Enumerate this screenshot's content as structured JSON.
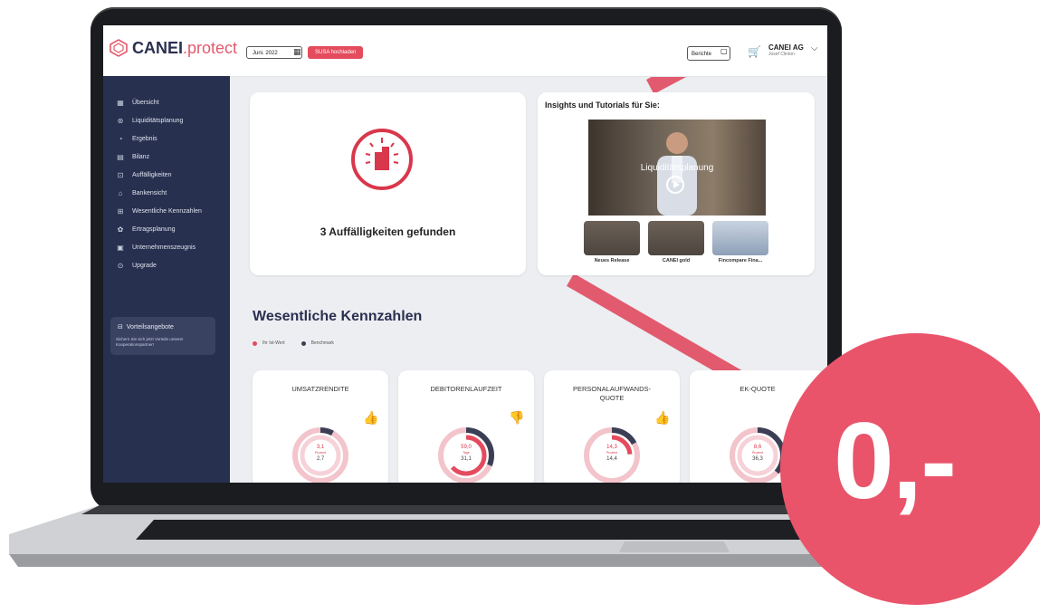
{
  "app": {
    "brand_main": "CANEI",
    "brand_accent": ".protect"
  },
  "topbar": {
    "date": "Juni. 2022",
    "susa_button": "SUSA hochladen",
    "reports_button": "Berichte",
    "user_company": "CANEI AG",
    "user_name": "Josef Clinton"
  },
  "sidebar": {
    "items": [
      {
        "label": "Übersicht",
        "icon": "grid-icon"
      },
      {
        "label": "Liquiditätsplanung",
        "icon": "liquidity-icon"
      },
      {
        "label": "Ergebnis",
        "icon": "result-icon"
      },
      {
        "label": "Bilanz",
        "icon": "balance-icon"
      },
      {
        "label": "Auffälligkeiten",
        "icon": "alert-icon"
      },
      {
        "label": "Bankensicht",
        "icon": "bank-icon"
      },
      {
        "label": "Wesentliche Kennzahlen",
        "icon": "kpi-icon"
      },
      {
        "label": "Ertragsplanung",
        "icon": "revenue-icon"
      },
      {
        "label": "Unternehmenszeugnis",
        "icon": "certificate-icon"
      },
      {
        "label": "Upgrade",
        "icon": "upgrade-icon"
      }
    ],
    "offer_title": "Vorteilsangebote",
    "offer_text": "Sichern Sie sich jetzt Vorteile unserer Kooperationspartner!"
  },
  "alert_card": {
    "title": "3 Auffälligkeiten gefunden"
  },
  "insights": {
    "title": "Insights und Tutorials für Sie:",
    "video_label": "Liquiditätsplanung",
    "thumbs": [
      "Neues Release",
      "CANEI gold",
      "Fincompare Fina..."
    ]
  },
  "kpis": {
    "section_title": "Wesentliche Kennzahlen",
    "legend_actual": "Ihr Ist-Wert",
    "legend_benchmark": "Benchmark",
    "cards": [
      {
        "title": "UMSATZRENDITE",
        "value": "3,1",
        "unit": "Prozent",
        "benchmark": "2,7",
        "trend": "up"
      },
      {
        "title": "DEBITORENLAUFZEIT",
        "value": "59,0",
        "unit": "Tage",
        "benchmark": "31,1",
        "trend": "down"
      },
      {
        "title": "PERSONALAUFWANDS-QUOTE",
        "value": "14,3",
        "unit": "Prozent",
        "benchmark": "14,4",
        "trend": "up"
      },
      {
        "title": "EK-QUOTE",
        "value": "8,6",
        "unit": "Prozent",
        "benchmark": "36,3",
        "trend": "down"
      }
    ]
  },
  "badge": {
    "price": "0,-"
  },
  "colors": {
    "accent": "#e44b5d",
    "sidebar": "#27304f",
    "badge": "#e9546b"
  }
}
